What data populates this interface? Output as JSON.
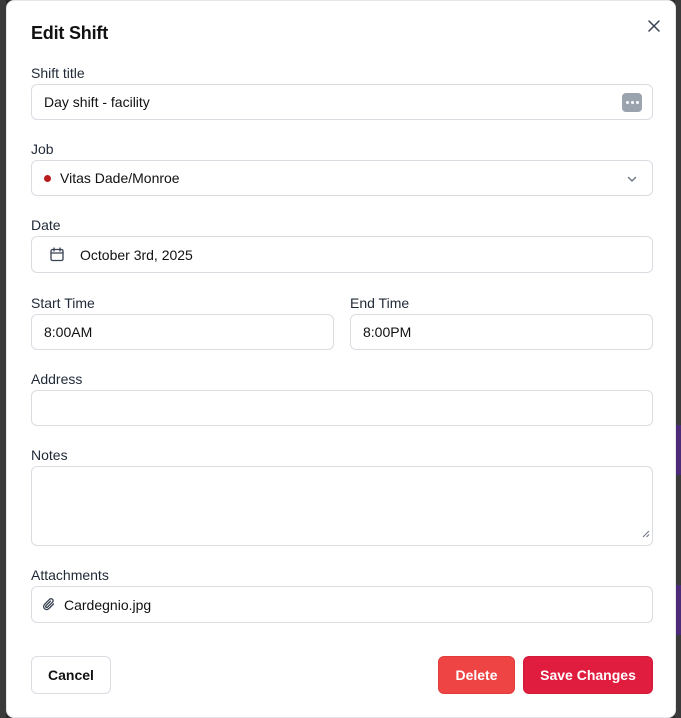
{
  "dialog": {
    "title": "Edit Shift",
    "close_icon": "close-icon"
  },
  "shift_title": {
    "label": "Shift title",
    "value": "Day shift - facility",
    "badge_icon": "more-dots-icon"
  },
  "job": {
    "label": "Job",
    "value": "Vitas Dade/Monroe",
    "dot_color": "#b91c1c",
    "icon": "chevron-down-icon"
  },
  "date": {
    "label": "Date",
    "value": "October 3rd, 2025",
    "icon": "calendar-icon"
  },
  "start_time": {
    "label": "Start Time",
    "value": "8:00AM"
  },
  "end_time": {
    "label": "End Time",
    "value": "8:00PM"
  },
  "address": {
    "label": "Address",
    "value": ""
  },
  "notes": {
    "label": "Notes",
    "value": ""
  },
  "attachments": {
    "label": "Attachments",
    "file_name": "Cardegnio.jpg",
    "icon": "paperclip-icon"
  },
  "footer": {
    "cancel_label": "Cancel",
    "delete_label": "Delete",
    "save_label": "Save Changes"
  },
  "colors": {
    "delete": "#ef4444",
    "save": "#e11d3f",
    "job_dot": "#b91c1c"
  }
}
